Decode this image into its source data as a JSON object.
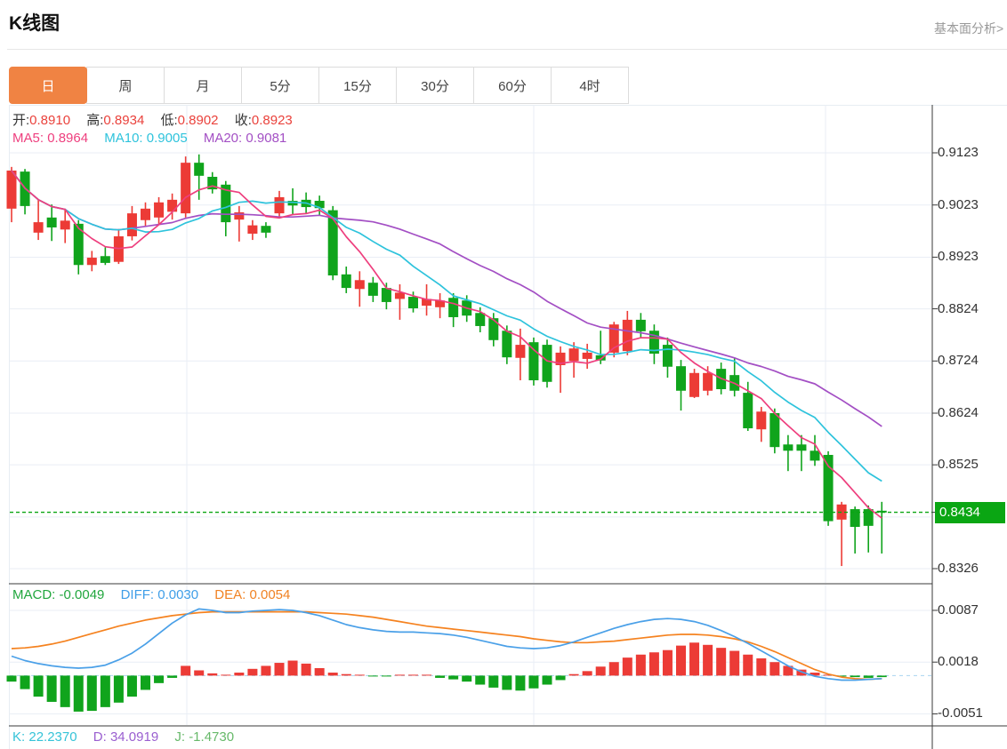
{
  "header": {
    "title": "K线图",
    "right_link": "基本面分析>"
  },
  "tabs": [
    {
      "label": "日",
      "active": true
    },
    {
      "label": "周",
      "active": false
    },
    {
      "label": "月",
      "active": false
    },
    {
      "label": "5分",
      "active": false
    },
    {
      "label": "15分",
      "active": false
    },
    {
      "label": "30分",
      "active": false
    },
    {
      "label": "60分",
      "active": false
    },
    {
      "label": "4时",
      "active": false
    }
  ],
  "main_legend": {
    "ohlc": [
      {
        "label": "开:",
        "value": "0.8910"
      },
      {
        "label": "高:",
        "value": "0.8934"
      },
      {
        "label": "低:",
        "value": "0.8902"
      },
      {
        "label": "收:",
        "value": "0.8923"
      }
    ],
    "ma": [
      {
        "label": "MA5:",
        "value": "0.8964"
      },
      {
        "label": "MA10:",
        "value": "0.9005"
      },
      {
        "label": "MA20:",
        "value": "0.9081"
      }
    ]
  },
  "macd_legend": [
    {
      "label": "MACD:",
      "value": "-0.0049"
    },
    {
      "label": "DIFF:",
      "value": "0.0030"
    },
    {
      "label": "DEA:",
      "value": "0.0054"
    }
  ],
  "kdj_legend": [
    {
      "label": "K:",
      "value": "22.2370"
    },
    {
      "label": "D:",
      "value": "34.0919"
    },
    {
      "label": "J:",
      "value": "-1.4730"
    }
  ],
  "price_axis": {
    "labels": [
      "0.9123",
      "0.9023",
      "0.8923",
      "0.8824",
      "0.8724",
      "0.8624",
      "0.8525",
      "0.8326"
    ],
    "current_badge": "0.8434"
  },
  "macd_axis": {
    "labels": [
      "0.0087",
      "0.0018",
      "-0.0051"
    ]
  },
  "colors": {
    "up": "#ec3b36",
    "down": "#10a41c",
    "ma5": "#ee3f7e",
    "ma10": "#2ec3dc",
    "ma20": "#a34fc4",
    "diff_line": "#4aa0e8",
    "dea_line": "#f5821f",
    "badge": "#0aa613",
    "price_dotted": "#0aa613",
    "zero_dashed": "#a9d4f0",
    "grid": "#e9eef5",
    "axis": "#3a3a3a",
    "tab_active_bg": "#f08343"
  },
  "chart_data": {
    "type": "candlestick",
    "panes": [
      "price+MA",
      "MACD"
    ],
    "price_pane": {
      "ticks": [
        0.9123,
        0.9023,
        0.8923,
        0.8824,
        0.8724,
        0.8624,
        0.8525,
        0.8425,
        0.8326
      ],
      "current_price": 0.8434,
      "ma_periods": [
        5,
        10,
        20
      ],
      "candles": [
        [
          0.9016,
          0.9096,
          0.899,
          0.9089
        ],
        [
          0.9087,
          0.9092,
          0.9005,
          0.9021
        ],
        [
          0.897,
          0.9033,
          0.8956,
          0.899
        ],
        [
          0.8999,
          0.9024,
          0.8954,
          0.898
        ],
        [
          0.8976,
          0.9016,
          0.895,
          0.8993
        ],
        [
          0.8987,
          0.8994,
          0.889,
          0.8908
        ],
        [
          0.8908,
          0.8935,
          0.8896,
          0.8922
        ],
        [
          0.8925,
          0.8942,
          0.8908,
          0.8912
        ],
        [
          0.8914,
          0.8977,
          0.891,
          0.8963
        ],
        [
          0.8963,
          0.9021,
          0.8955,
          0.9007
        ],
        [
          0.8994,
          0.9028,
          0.8982,
          0.9016
        ],
        [
          0.8999,
          0.9038,
          0.8987,
          0.9028
        ],
        [
          0.901,
          0.9045,
          0.8995,
          0.9033
        ],
        [
          0.9007,
          0.9116,
          0.8999,
          0.9104
        ],
        [
          0.9104,
          0.912,
          0.9033,
          0.9079
        ],
        [
          0.9077,
          0.9086,
          0.9045,
          0.9053
        ],
        [
          0.9062,
          0.9069,
          0.8963,
          0.899
        ],
        [
          0.8995,
          0.9021,
          0.8953,
          0.9009
        ],
        [
          0.8968,
          0.8994,
          0.8956,
          0.8984
        ],
        [
          0.8983,
          0.899,
          0.896,
          0.897
        ],
        [
          0.9007,
          0.905,
          0.8997,
          0.9038
        ],
        [
          0.9031,
          0.9055,
          0.9004,
          0.9022
        ],
        [
          0.9033,
          0.9047,
          0.9007,
          0.9019
        ],
        [
          0.9031,
          0.9041,
          0.9004,
          0.9017
        ],
        [
          0.9013,
          0.9021,
          0.8879,
          0.8888
        ],
        [
          0.889,
          0.8905,
          0.8854,
          0.8864
        ],
        [
          0.8862,
          0.8896,
          0.8828,
          0.8879
        ],
        [
          0.8874,
          0.8885,
          0.8837,
          0.8849
        ],
        [
          0.8864,
          0.8874,
          0.8823,
          0.8837
        ],
        [
          0.8843,
          0.8871,
          0.8803,
          0.8855
        ],
        [
          0.8847,
          0.8857,
          0.8817,
          0.8825
        ],
        [
          0.883,
          0.8871,
          0.8811,
          0.8843
        ],
        [
          0.8827,
          0.8854,
          0.8806,
          0.884
        ],
        [
          0.8845,
          0.8854,
          0.8789,
          0.8808
        ],
        [
          0.884,
          0.885,
          0.8799,
          0.8811
        ],
        [
          0.8816,
          0.8827,
          0.8779,
          0.8791
        ],
        [
          0.8806,
          0.8816,
          0.8752,
          0.8764
        ],
        [
          0.8782,
          0.8792,
          0.8718,
          0.8731
        ],
        [
          0.873,
          0.8786,
          0.8687,
          0.8755
        ],
        [
          0.876,
          0.8769,
          0.8677,
          0.8687
        ],
        [
          0.8755,
          0.8765,
          0.8673,
          0.8684
        ],
        [
          0.8716,
          0.8752,
          0.8663,
          0.874
        ],
        [
          0.8724,
          0.876,
          0.8692,
          0.8748
        ],
        [
          0.8728,
          0.8757,
          0.8709,
          0.874
        ],
        [
          0.8735,
          0.8782,
          0.8718,
          0.8725
        ],
        [
          0.874,
          0.8799,
          0.8731,
          0.8794
        ],
        [
          0.8743,
          0.882,
          0.8735,
          0.8803
        ],
        [
          0.8803,
          0.8816,
          0.8769,
          0.8781
        ],
        [
          0.8782,
          0.8794,
          0.8718,
          0.8738
        ],
        [
          0.8755,
          0.8769,
          0.8692,
          0.8713
        ],
        [
          0.8714,
          0.8726,
          0.8629,
          0.8667
        ],
        [
          0.8655,
          0.8709,
          0.8653,
          0.8701
        ],
        [
          0.8667,
          0.8714,
          0.8658,
          0.8701
        ],
        [
          0.8709,
          0.8721,
          0.866,
          0.867
        ],
        [
          0.8697,
          0.873,
          0.8656,
          0.8667
        ],
        [
          0.8663,
          0.8684,
          0.859,
          0.8595
        ],
        [
          0.8593,
          0.8636,
          0.8569,
          0.8627
        ],
        [
          0.8624,
          0.8633,
          0.8547,
          0.8559
        ],
        [
          0.8564,
          0.8582,
          0.8513,
          0.8552
        ],
        [
          0.8564,
          0.8582,
          0.8513,
          0.8552
        ],
        [
          0.8552,
          0.8582,
          0.8523,
          0.8533
        ],
        [
          0.8544,
          0.8551,
          0.8408,
          0.8417
        ],
        [
          0.842,
          0.8454,
          0.8331,
          0.8449
        ],
        [
          0.844,
          0.8445,
          0.8355,
          0.8406
        ],
        [
          0.844,
          0.8447,
          0.8357,
          0.8408
        ],
        [
          0.8437,
          0.8454,
          0.8355,
          0.8434
        ]
      ]
    },
    "macd_pane": {
      "ticks": [
        0.0087,
        0.0018,
        -0.0051
      ],
      "hist": [
        -0.0008,
        -0.0018,
        -0.0028,
        -0.0035,
        -0.0042,
        -0.0048,
        -0.0047,
        -0.0042,
        -0.0036,
        -0.0028,
        -0.0019,
        -0.001,
        -0.0003,
        0.0013,
        0.0007,
        0.0003,
        0.0001,
        0.0004,
        0.0009,
        0.0013,
        0.0017,
        0.002,
        0.0016,
        0.001,
        0.0004,
        0.0002,
        0.0001,
        -0.0001,
        -0.0001,
        0.0,
        0.0,
        0.0,
        -0.0003,
        -0.0005,
        -0.0008,
        -0.0012,
        -0.0016,
        -0.0019,
        -0.002,
        -0.0017,
        -0.0012,
        -0.0006,
        0.0002,
        0.0006,
        0.0012,
        0.0018,
        0.0024,
        0.0028,
        0.0031,
        0.0034,
        0.004,
        0.0044,
        0.0041,
        0.0037,
        0.0033,
        0.0028,
        0.0023,
        0.0018,
        0.0013,
        0.0008,
        0.0004,
        0.0001,
        -0.0001,
        -0.0002,
        -0.0003,
        -0.0002
      ],
      "diff": [
        0.0026,
        0.002,
        0.0016,
        0.0013,
        0.0011,
        0.001,
        0.0011,
        0.0014,
        0.0021,
        0.003,
        0.0042,
        0.0056,
        0.007,
        0.0081,
        0.0089,
        0.0087,
        0.0084,
        0.0084,
        0.0086,
        0.0087,
        0.0088,
        0.0087,
        0.0084,
        0.008,
        0.0074,
        0.0068,
        0.0064,
        0.0061,
        0.0059,
        0.0058,
        0.0058,
        0.0057,
        0.0056,
        0.0054,
        0.0051,
        0.0047,
        0.0043,
        0.0039,
        0.0037,
        0.0036,
        0.0037,
        0.004,
        0.0045,
        0.0051,
        0.0057,
        0.0063,
        0.0068,
        0.0072,
        0.0075,
        0.0076,
        0.0075,
        0.0072,
        0.0067,
        0.006,
        0.0052,
        0.0043,
        0.0033,
        0.0023,
        0.0013,
        0.0005,
        -0.0001,
        -0.0004,
        -0.0006,
        -0.0006,
        -0.0005,
        -0.0004
      ],
      "dea": [
        0.0036,
        0.0037,
        0.0039,
        0.0042,
        0.0046,
        0.0051,
        0.0056,
        0.0061,
        0.0066,
        0.007,
        0.0074,
        0.0077,
        0.008,
        0.0082,
        0.0084,
        0.0085,
        0.0085,
        0.0085,
        0.0085,
        0.0085,
        0.0085,
        0.0085,
        0.0085,
        0.0084,
        0.0083,
        0.0082,
        0.008,
        0.0078,
        0.0075,
        0.0072,
        0.0069,
        0.0066,
        0.0064,
        0.0062,
        0.006,
        0.0058,
        0.0056,
        0.0054,
        0.0052,
        0.0049,
        0.0047,
        0.0045,
        0.0044,
        0.0044,
        0.0045,
        0.0046,
        0.0048,
        0.005,
        0.0052,
        0.0054,
        0.0055,
        0.0055,
        0.0054,
        0.0052,
        0.0049,
        0.0045,
        0.0039,
        0.0032,
        0.0024,
        0.0016,
        0.0008,
        0.0002,
        -0.0002,
        -0.0004,
        -0.0005,
        -0.0004
      ]
    }
  }
}
